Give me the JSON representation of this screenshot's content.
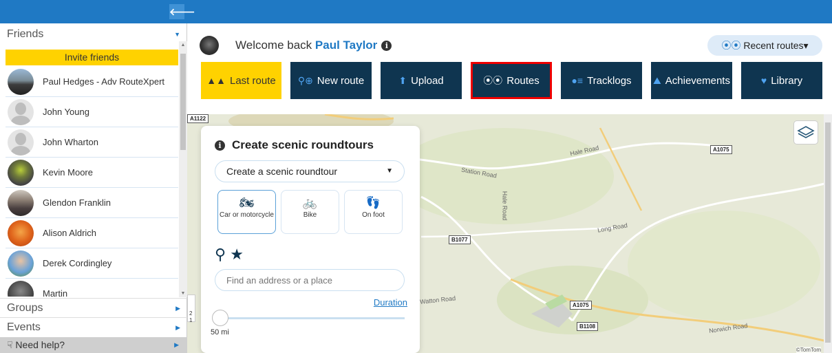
{
  "sidebar": {
    "friends_header": "Friends",
    "invite_label": "Invite friends",
    "friends": [
      {
        "name": "Paul Hedges - Adv RouteXpert",
        "avatar": "photo-motorbikes"
      },
      {
        "name": "John Young",
        "avatar": "placeholder"
      },
      {
        "name": "John Wharton",
        "avatar": "placeholder"
      },
      {
        "name": "Kevin Moore",
        "avatar": "photo-rider"
      },
      {
        "name": "Glendon Franklin",
        "avatar": "photo-bikes"
      },
      {
        "name": "Alison Aldrich",
        "avatar": "photo-orange"
      },
      {
        "name": "Derek Cordingley",
        "avatar": "photo-man"
      },
      {
        "name": "Martin",
        "avatar": "photo-dark"
      }
    ],
    "groups_label": "Groups",
    "events_label": "Events",
    "help_label": "Need help?"
  },
  "header": {
    "welcome_text": "Welcome back",
    "user_name": "Paul Taylor",
    "recent_routes_label": "Recent routes▾"
  },
  "nav": {
    "last_route": "Last route",
    "new_route": "New route",
    "upload": "Upload",
    "routes": "Routes",
    "tracklogs": "Tracklogs",
    "achievements": "Achievements",
    "library": "Library"
  },
  "panel": {
    "title": "Create scenic roundtours",
    "dropdown_value": "Create a scenic roundtour",
    "modes": {
      "car": "Car or motorcycle",
      "bike": "Bike",
      "foot": "On foot"
    },
    "address_placeholder": "Find an address or a place",
    "duration_link": "Duration",
    "distance_value": "50 mi"
  },
  "map": {
    "road_labels": [
      "Hale Road",
      "Station Road",
      "Hale Road",
      "Long Road",
      "Watton Road",
      "Norwich Road"
    ],
    "road_badges": [
      "A1075",
      "B1077",
      "A1075",
      "B1108",
      "A1122"
    ],
    "scale_labels": [
      "2",
      "1"
    ],
    "credit": "©TomTom"
  },
  "colors": {
    "topbar": "#1f79c4",
    "nav_dark": "#0f3550",
    "accent_yellow": "#ffd200",
    "selected_outline": "#e00000"
  }
}
